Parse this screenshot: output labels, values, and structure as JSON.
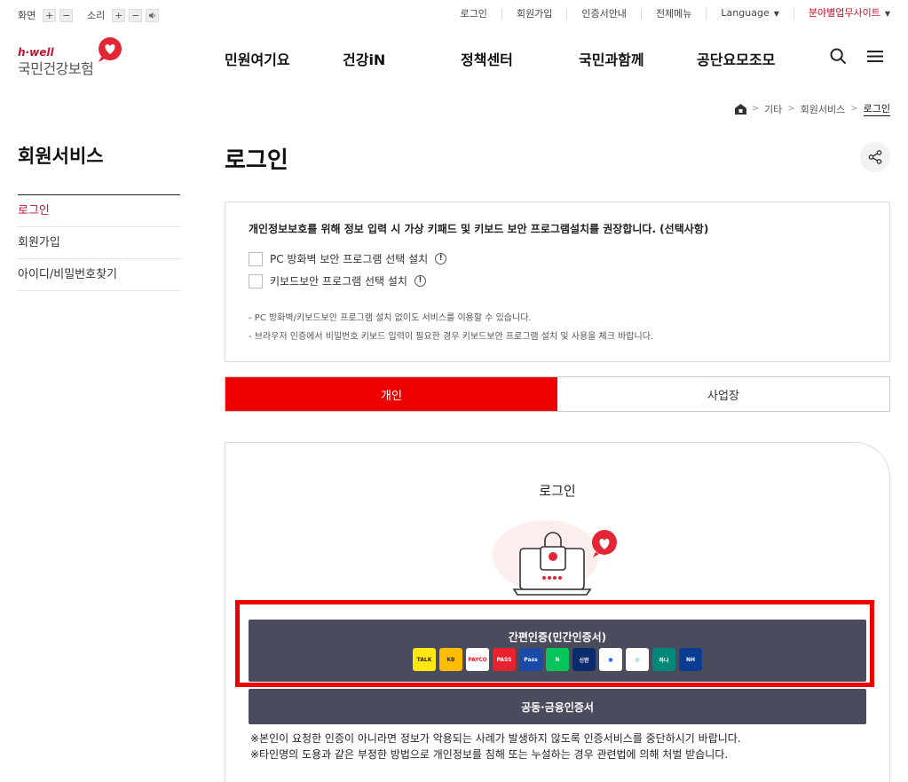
{
  "util": {
    "screen_label": "화면",
    "sound_label": "소리",
    "plus": "+",
    "minus": "−",
    "links": [
      "로그인",
      "회원가입",
      "인증서안내",
      "전체메뉴"
    ],
    "language": "Language",
    "field_sites": "분야별업무사이트",
    "dropdown_arrow": "▼"
  },
  "logo": {
    "top": "h·well",
    "name": "국민건강보험"
  },
  "gnb": [
    "민원여기요",
    "건강iN",
    "정책센터",
    "국민과함께",
    "공단요모조모"
  ],
  "breadcrumb": {
    "items": [
      "기타",
      "회원서비스"
    ],
    "current": "로그인",
    "sep": ">"
  },
  "lnb": {
    "title": "회원서비스",
    "items": [
      "로그인",
      "회원가입",
      "아이디/비밀번호찾기"
    ],
    "active_index": 0
  },
  "page_title": "로그인",
  "security": {
    "heading": "개인정보보호를 위해 정보 입력 시 가상 키패드 및 키보드 보안 프로그램설치를 권장합니다. (선택사항)",
    "options": [
      "PC 방화벽 보안 프로그램 선택 설치",
      "키보드보안 프로그램 선택 설치"
    ],
    "info_glyph": "!",
    "notes": [
      "-  PC 방화벽/키보드보안 프로그램 설치 없이도 서비스를 이용할 수 있습니다.",
      "-  브라우저 인증에서 비밀번호 키보드 입력이 필요한 경우 키보드보안 프로그램 설치 및 사용을 체크 바랍니다."
    ]
  },
  "tabs": {
    "items": [
      "개인",
      "사업장"
    ],
    "active_index": 0
  },
  "login": {
    "title": "로그인",
    "simple_auth_label": "간편인증(민간인증서)",
    "providers": [
      {
        "name": "kakao-talk",
        "text": "TALK",
        "color": "#ffe812",
        "fg": "#3a1d1d"
      },
      {
        "name": "kb",
        "text": "KB",
        "color": "#ffbc00",
        "fg": "#333"
      },
      {
        "name": "payco",
        "text": "PAYCO",
        "color": "#ffffff",
        "fg": "#e61e2b"
      },
      {
        "name": "pass",
        "text": "PASS",
        "color": "#e8212e",
        "fg": "#fff"
      },
      {
        "name": "samsung-pass",
        "text": "Pass",
        "color": "#1b4ba8",
        "fg": "#fff"
      },
      {
        "name": "naver",
        "text": "N",
        "color": "#03c75a",
        "fg": "#fff"
      },
      {
        "name": "shinhan",
        "text": "신한",
        "color": "#0a2b6e",
        "fg": "#fff"
      },
      {
        "name": "toss",
        "text": "●",
        "color": "#ffffff",
        "fg": "#1f7af0"
      },
      {
        "name": "bank-salad",
        "text": "◎",
        "color": "#ffffff",
        "fg": "#21b36b"
      },
      {
        "name": "hana",
        "text": "하나",
        "color": "#00887a",
        "fg": "#fff"
      },
      {
        "name": "nh",
        "text": "NH",
        "color": "#0a3d91",
        "fg": "#fff"
      }
    ],
    "cert_label": "공동·금융인증서",
    "warnings": [
      "※본인이 요청한 인증이 아니라면 정보가 악용되는 사례가 발생하지 않도록 인증서비스를 중단하시기 바랍니다.",
      "※타인명의 도용과 같은 부정한 방법으로 개인정보를 침해 또는 누설하는 경우 관련법에 의해 처벌 받습니다."
    ]
  },
  "colors": {
    "brand_red": "#ee0000",
    "button_dark": "#4a4c5e"
  }
}
